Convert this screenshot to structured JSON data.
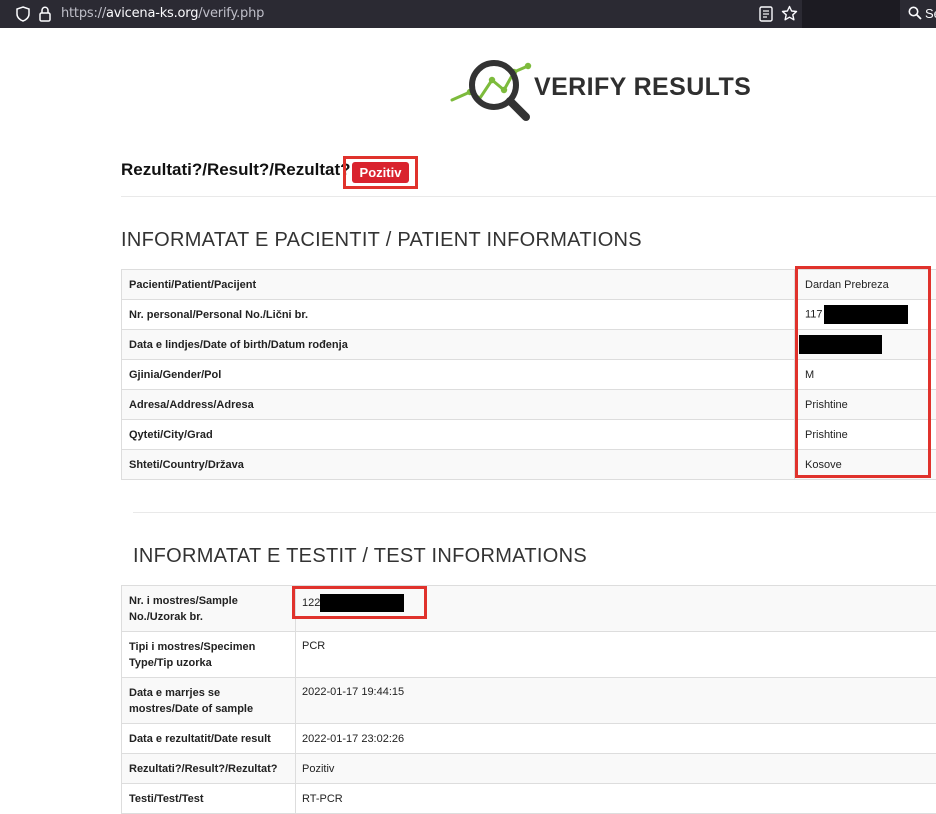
{
  "browser": {
    "url_prefix": "https://",
    "url_host": "avicena-ks.org",
    "url_path": "/verify.php",
    "search_text": "Se"
  },
  "logo": {
    "text": "VERIFY RESULTS"
  },
  "result_header": {
    "label": "Rezultati?/Result?/Rezultat?:",
    "badge": "Pozitiv"
  },
  "patient": {
    "title": "INFORMATAT E PACIENTIT / PATIENT INFORMATIONS",
    "rows": [
      {
        "label": "Pacienti/Patient/Pacijent",
        "value": "Dardan Prebreza"
      },
      {
        "label": "Nr. personal/Personal No./Lični br.",
        "value": "117"
      },
      {
        "label": "Data e lindjes/Date of birth/Datum rođenja",
        "value": ""
      },
      {
        "label": "Gjinia/Gender/Pol",
        "value": "M"
      },
      {
        "label": "Adresa/Address/Adresa",
        "value": "Prishtine"
      },
      {
        "label": "Qyteti/City/Grad",
        "value": "Prishtine"
      },
      {
        "label": "Shteti/Country/Država",
        "value": "Kosove"
      }
    ]
  },
  "test": {
    "title": "INFORMATAT E TESTIT / TEST INFORMATIONS",
    "rows": [
      {
        "label_1": "Nr. i mostres/Sample",
        "label_2": "No./Uzorak br.",
        "value": "122"
      },
      {
        "label_1": "Tipi i mostres/Specimen",
        "label_2": "Type/Tip uzorka",
        "value": "PCR"
      },
      {
        "label_1": "Data e marrjes se",
        "label_2": "mostres/Date of sample",
        "value": "2022-01-17 19:44:15"
      },
      {
        "label_1": "Data e rezultatit/Date result",
        "value": "2022-01-17 23:02:26"
      },
      {
        "label_1": "Rezultati?/Result?/Rezultat?",
        "value": "Pozitiv"
      },
      {
        "label_1": "Testi/Test/Test",
        "value": "RT-PCR"
      }
    ]
  }
}
